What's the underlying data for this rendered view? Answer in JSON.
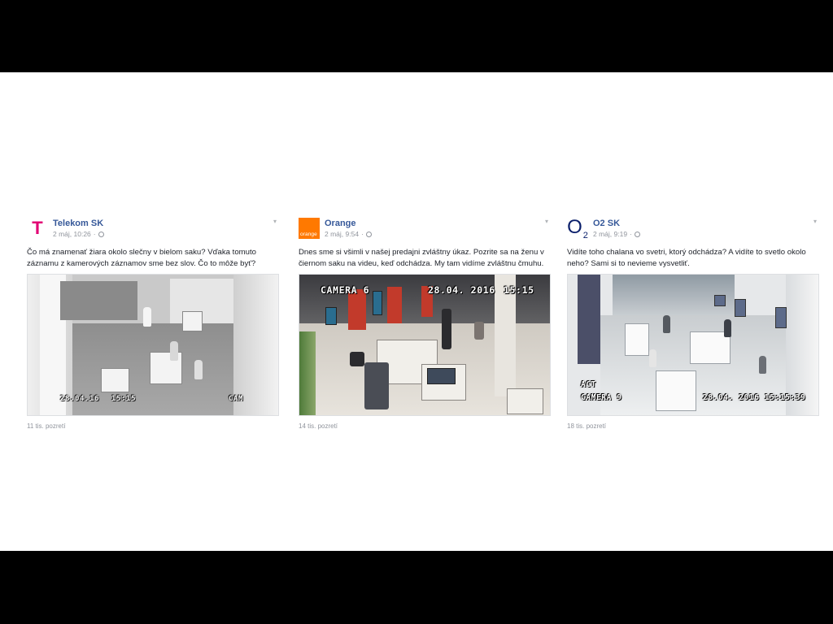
{
  "posts": [
    {
      "page_name": "Telekom SK",
      "avatar_text": "T",
      "time": "2 máj, 10:26",
      "text": "Čo má znamenať žiara okolo slečny v bielom saku? Vďaka tomuto záznamu z kamerových záznamov sme bez slov. Čo to môže byť?",
      "video_overlay": {
        "date": "28.04.16",
        "time": "15:15",
        "label": "CAM"
      },
      "views": "11 tis. pozretí"
    },
    {
      "page_name": "Orange",
      "avatar_text": "orange",
      "time": "2 máj, 9:54",
      "text": "Dnes sme si všimli v našej predajni zvláštny úkaz. Pozrite sa na ženu v čiernom saku na videu, keď odchádza. My tam vidíme zvláštnu čmuhu.",
      "video_overlay": {
        "camera": "CAMERA 6",
        "date": "28.04. 2016",
        "time": "15:15"
      },
      "views": "14 tis. pozretí"
    },
    {
      "page_name": "O2 SK",
      "avatar_text": "O",
      "avatar_sub": "2",
      "time": "2 máj, 9:19",
      "text": "Vidíte toho chalana vo svetri, ktorý odchádza? A vidíte to svetlo okolo neho? Sami si to nevieme vysvetliť.",
      "video_overlay": {
        "act": "ACT",
        "camera": "CAMERA 9",
        "datetime": "28.04. 2016 15:15:39"
      },
      "views": "18 tis. pozretí"
    }
  ],
  "colors": {
    "page_name": "#365899",
    "meta": "#90949c",
    "telekom_brand": "#e20074",
    "orange_brand": "#ff7900",
    "o2_brand": "#0a1f6b"
  },
  "icons": {
    "privacy": "globe-icon",
    "post_menu": "chevron-down-icon"
  }
}
